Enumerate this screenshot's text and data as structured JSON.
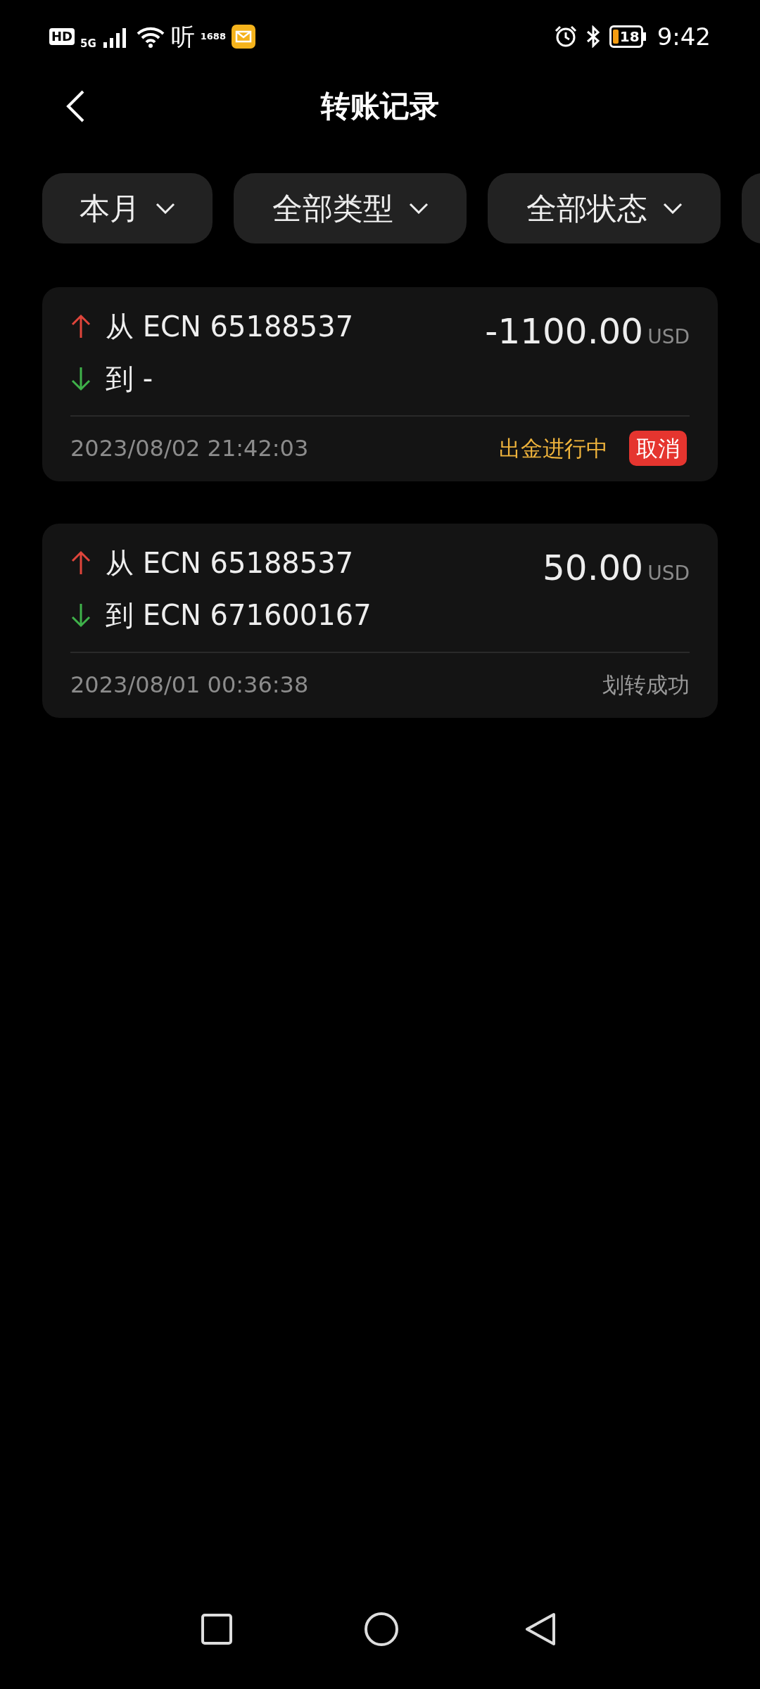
{
  "status_bar": {
    "hd": "HD",
    "network": "5G",
    "app_glyph": "听",
    "app_badge": "1688",
    "battery": "18",
    "time": "9:42"
  },
  "header": {
    "title": "转账记录"
  },
  "filters": [
    {
      "label": "本月"
    },
    {
      "label": "全部类型"
    },
    {
      "label": "全部状态"
    }
  ],
  "transfers": [
    {
      "from": "从 ECN 65188537",
      "to": "到 -",
      "amount": "-1100.00",
      "currency": "USD",
      "time": "2023/08/02 21:42:03",
      "status": "出金进行中",
      "pending": true,
      "action": "取消"
    },
    {
      "from": "从 ECN 65188537",
      "to": "到 ECN 671600167",
      "amount": "50.00",
      "currency": "USD",
      "time": "2023/08/01 00:36:38",
      "status": "划转成功",
      "pending": false
    }
  ]
}
